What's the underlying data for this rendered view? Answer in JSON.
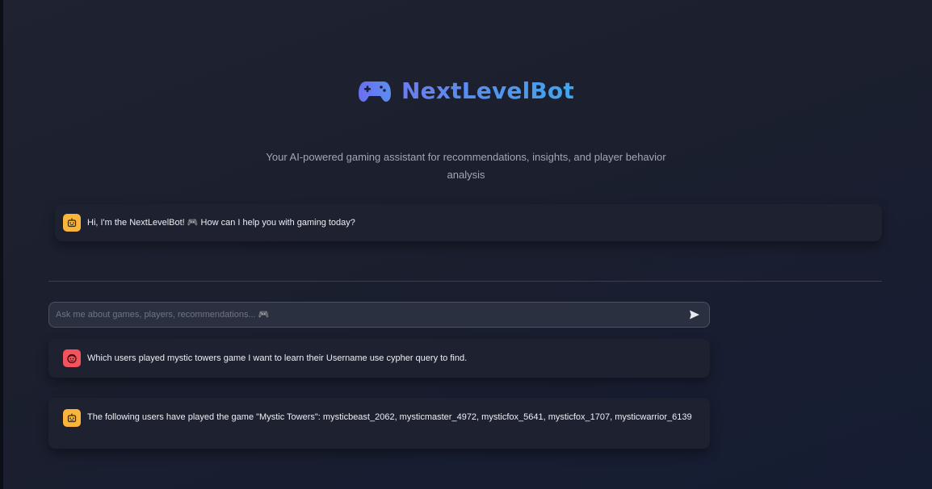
{
  "app": {
    "title": "NextLevelBot",
    "subtitle": "Your AI-powered gaming assistant for recommendations, insights, and player behavior analysis",
    "logo_icon": "gamepad-icon",
    "title_colors": [
      "#6b7df0",
      "#3fa6ee"
    ]
  },
  "chat": {
    "welcome": {
      "role": "bot",
      "icon": "bot-icon",
      "text": "Hi, I'm the NextLevelBot! 🎮 How can I help you with gaming today?"
    },
    "input": {
      "placeholder": "Ask me about games, players, recommendations... 🎮",
      "value": "",
      "send_icon": "send-icon"
    },
    "messages": [
      {
        "role": "user",
        "icon": "user-face-icon",
        "text": "Which users played mystic towers game I want to learn their Username use cypher query to find."
      },
      {
        "role": "bot",
        "icon": "bot-icon",
        "text": "The following users have played the game \"Mystic Towers\": mysticbeast_2062, mysticmaster_4972, mysticfox_5641, mysticfox_1707, mysticwarrior_6139"
      }
    ]
  },
  "colors": {
    "bot_avatar": "#fbb53b",
    "user_avatar": "#f3535d",
    "card_bg": "#1d2130",
    "page_bg": "#1b1f2e"
  }
}
